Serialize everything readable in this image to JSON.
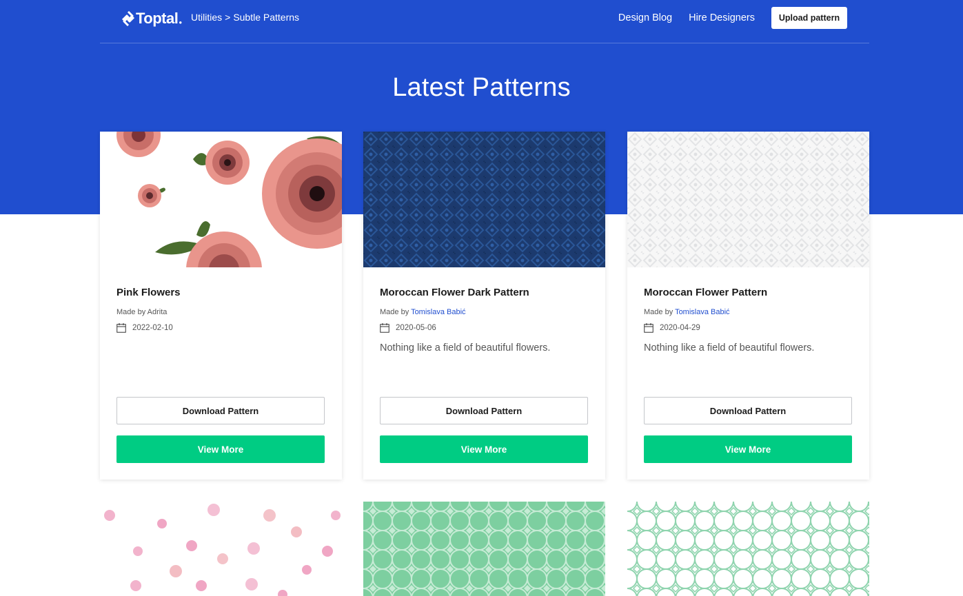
{
  "header": {
    "logo_text": "Toptal",
    "breadcrumb": {
      "parent": "Utilities",
      "separator": ">",
      "current": "Subtle Patterns"
    },
    "nav": {
      "design_blog": "Design Blog",
      "hire_designers": "Hire Designers",
      "upload": "Upload pattern"
    },
    "brand_color": "#204ecf"
  },
  "page_title": "Latest Patterns",
  "cards": [
    {
      "title": "Pink Flowers",
      "made_by_prefix": "Made by",
      "author": "Adrita",
      "author_linked": false,
      "date": "2022-02-10",
      "description": "",
      "download_label": "Download Pattern",
      "view_label": "View More"
    },
    {
      "title": "Moroccan Flower Dark Pattern",
      "made_by_prefix": "Made by",
      "author": "Tomislava Babić",
      "author_linked": true,
      "date": "2020-05-06",
      "description": "Nothing like a field of beautiful flowers.",
      "download_label": "Download Pattern",
      "view_label": "View More"
    },
    {
      "title": "Moroccan Flower Pattern",
      "made_by_prefix": "Made by",
      "author": "Tomislava Babić",
      "author_linked": true,
      "date": "2020-04-29",
      "description": "Nothing like a field of beautiful flowers.",
      "download_label": "Download Pattern",
      "view_label": "View More"
    }
  ],
  "accent_green": "#00cc83",
  "icons": {
    "calendar": "calendar-icon",
    "logo": "toptal-logo-icon"
  }
}
